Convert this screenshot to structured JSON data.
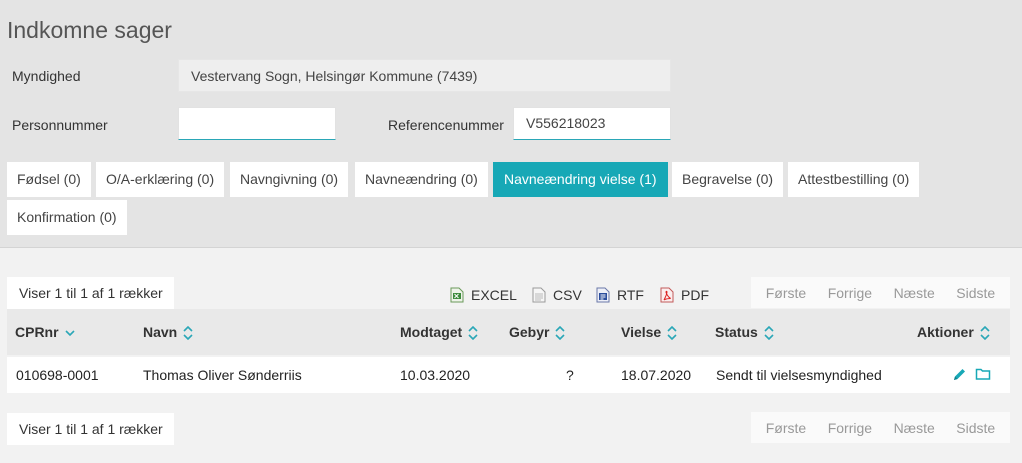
{
  "page": {
    "title": "Indkomne sager"
  },
  "form": {
    "authority_label": "Myndighed",
    "authority_value": "Vestervang Sogn, Helsingør Kommune (7439)",
    "cpr_label": "Personnummer",
    "cpr_value": "",
    "ref_label": "Referencenummer",
    "ref_value": "V556218023"
  },
  "tabs": [
    {
      "label": "Fødsel (0)"
    },
    {
      "label": "O/A-erklæring (0)"
    },
    {
      "label": "Navngivning (0)"
    },
    {
      "label": "Navneændring (0)"
    },
    {
      "label": "Navneændring vielse (1)",
      "active": true
    },
    {
      "label": "Begravelse (0)"
    },
    {
      "label": "Attestbestilling (0)"
    },
    {
      "label": "Konfirmation (0)"
    }
  ],
  "table": {
    "info_top": "Viser 1 til 1 af 1 rækker",
    "info_bottom": "Viser 1 til 1 af 1 rækker",
    "exports": {
      "excel": "EXCEL",
      "csv": "CSV",
      "rtf": "RTF",
      "pdf": "PDF"
    },
    "pager": {
      "first": "Første",
      "prev": "Forrige",
      "next": "Næste",
      "last": "Sidste"
    },
    "columns": {
      "cpr": "CPRnr",
      "name": "Navn",
      "received": "Modtaget",
      "fee": "Gebyr",
      "wedding": "Vielse",
      "status": "Status",
      "actions": "Aktioner"
    },
    "rows": [
      {
        "cpr": "010698-0001",
        "name": "Thomas Oliver Sønderriis",
        "received": "10.03.2020",
        "fee": "?",
        "wedding": "18.07.2020",
        "status": "Sendt til vielsesmyndighed"
      }
    ]
  },
  "colors": {
    "accent": "#17a8b6",
    "header_bg": "#e4e4e4",
    "page_bg": "#f2f2f2"
  },
  "icons": {
    "excel": "excel-file-icon",
    "csv": "csv-file-icon",
    "rtf": "rtf-file-icon",
    "pdf": "pdf-file-icon",
    "sort": "sort-icon",
    "sort_desc": "sort-desc-icon",
    "edit": "pencil-icon",
    "open": "folder-icon"
  }
}
